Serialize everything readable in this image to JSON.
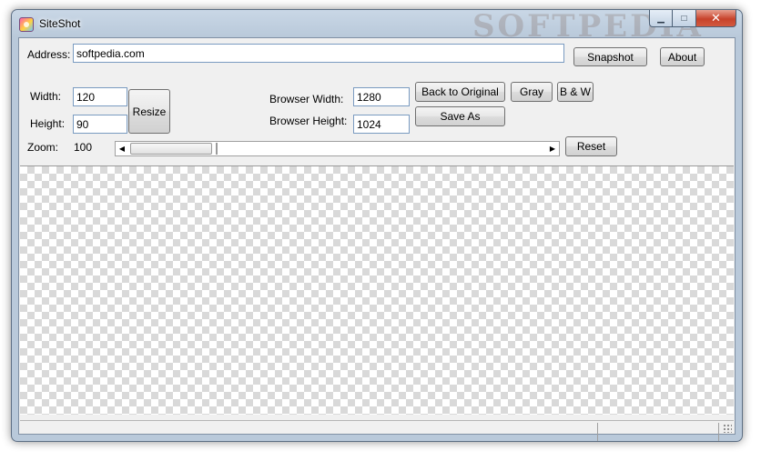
{
  "window": {
    "title": "SiteShot",
    "watermark": "SOFTPEDIA"
  },
  "controls": {
    "minimize": "▁",
    "maximize": "□",
    "close": "✕"
  },
  "address": {
    "label": "Address:",
    "value": "softpedia.com"
  },
  "buttons": {
    "snapshot": "Snapshot",
    "about": "About",
    "resize": "Resize",
    "back_to_original": "Back to Original",
    "gray": "Gray",
    "bw": "B & W",
    "save_as": "Save As",
    "reset": "Reset"
  },
  "size": {
    "width_label": "Width:",
    "width_value": "120",
    "height_label": "Height:",
    "height_value": "90"
  },
  "browser": {
    "width_label": "Browser Width:",
    "width_value": "1280",
    "height_label": "Browser Height:",
    "height_value": "1024"
  },
  "zoom": {
    "label": "Zoom:",
    "value": "100"
  },
  "scroll": {
    "left_arrow": "◀",
    "right_arrow": "▶"
  }
}
